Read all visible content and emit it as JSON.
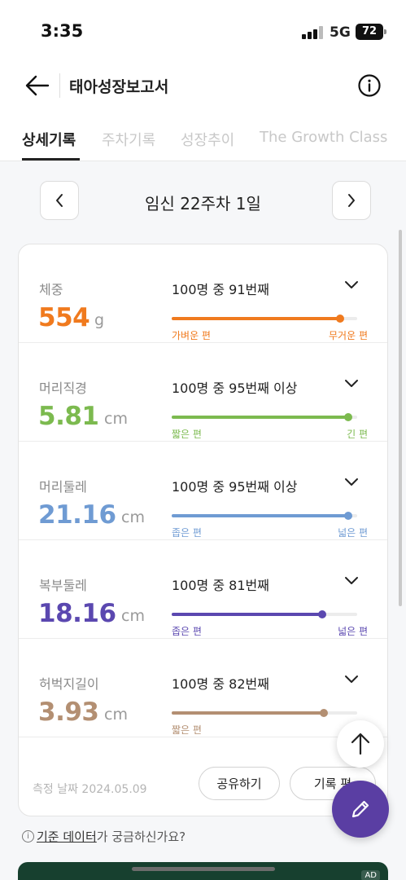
{
  "status_bar": {
    "time": "3:35",
    "network": "5G",
    "battery": "72"
  },
  "header": {
    "title": "태아성장보고서"
  },
  "tabs": [
    {
      "label": "상세기록",
      "active": true
    },
    {
      "label": "주차기록",
      "active": false
    },
    {
      "label": "성장추이",
      "active": false
    },
    {
      "label": "The Growth Class",
      "active": false
    }
  ],
  "week": {
    "label": "임신 22주차 1일"
  },
  "metrics": [
    {
      "label": "체중",
      "value": "554",
      "unit": "g",
      "rank": "100명 중 91번째",
      "percentile": 0.91,
      "left_label": "가벼운 편",
      "right_label": "무거운 편",
      "color": "#f07a1e"
    },
    {
      "label": "머리직경",
      "value": "5.81",
      "unit": "cm",
      "rank": "100명 중 95번째 이상",
      "percentile": 0.95,
      "left_label": "짧은 편",
      "right_label": "긴 편",
      "color": "#7cba4f"
    },
    {
      "label": "머리둘레",
      "value": "21.16",
      "unit": "cm",
      "rank": "100명 중 95번째 이상",
      "percentile": 0.95,
      "left_label": "좁은 편",
      "right_label": "넓은 편",
      "color": "#6f9bd3"
    },
    {
      "label": "복부둘레",
      "value": "18.16",
      "unit": "cm",
      "rank": "100명 중 81번째",
      "percentile": 0.81,
      "left_label": "좁은 편",
      "right_label": "넓은 편",
      "color": "#5b48b0"
    },
    {
      "label": "허벅지길이",
      "value": "3.93",
      "unit": "cm",
      "rank": "100명 중 82번째",
      "percentile": 0.82,
      "left_label": "짧은 편",
      "right_label": "",
      "color": "#b38f72"
    }
  ],
  "footer": {
    "measure_date": "측정 날짜 2024.05.09",
    "share_label": "공유하기",
    "record_label": "기록 편"
  },
  "question": {
    "link_text": "기준 데이터",
    "rest_text": "가 궁금하신가요?"
  },
  "ad": {
    "badge": "AD"
  }
}
